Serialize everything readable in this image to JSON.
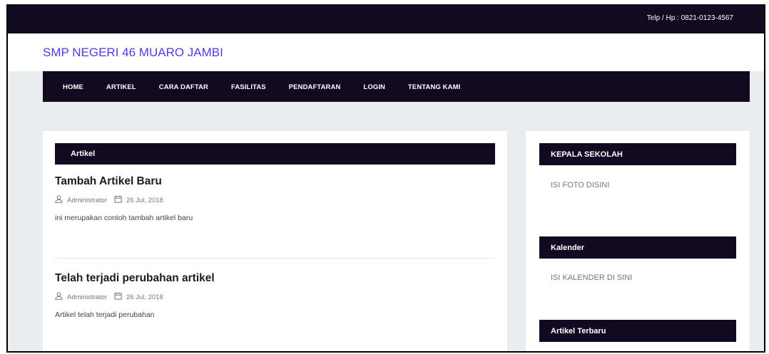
{
  "header": {
    "phone": "Telp / Hp : 0821-0123-4567",
    "site_title": "SMP NEGERI 46 MUARO JAMBI"
  },
  "nav": {
    "items": [
      "HOME",
      "ARTIKEL",
      "CARA DAFTAR",
      "FASILITAS",
      "PENDAFTARAN",
      "LOGIN",
      "TENTANG KAMI"
    ]
  },
  "main": {
    "section_title": "Artikel",
    "posts": [
      {
        "title": "Tambah Artikel Baru",
        "author": "Administrator",
        "date": "26 Jul, 2018",
        "excerpt": "ini merupakan contoh tambah artikel baru"
      },
      {
        "title": "Telah terjadi perubahan artikel",
        "author": "Administrator",
        "date": "26 Jul, 2018",
        "excerpt": "Artikel telah terjadi perubahan"
      }
    ]
  },
  "sidebar": {
    "widgets": [
      {
        "title": "KEPALA SEKOLAH",
        "body": "ISI FOTO DISINI"
      },
      {
        "title": "Kalender",
        "body": "ISI KALENDER DI SINI"
      },
      {
        "title": "Artikel Terbaru",
        "body": ""
      }
    ]
  },
  "colors": {
    "dark_navy": "#110a21",
    "brand_purple": "#5b36e0",
    "background": "#e9edf0"
  },
  "icons": [
    "user-icon",
    "calendar-icon"
  ]
}
